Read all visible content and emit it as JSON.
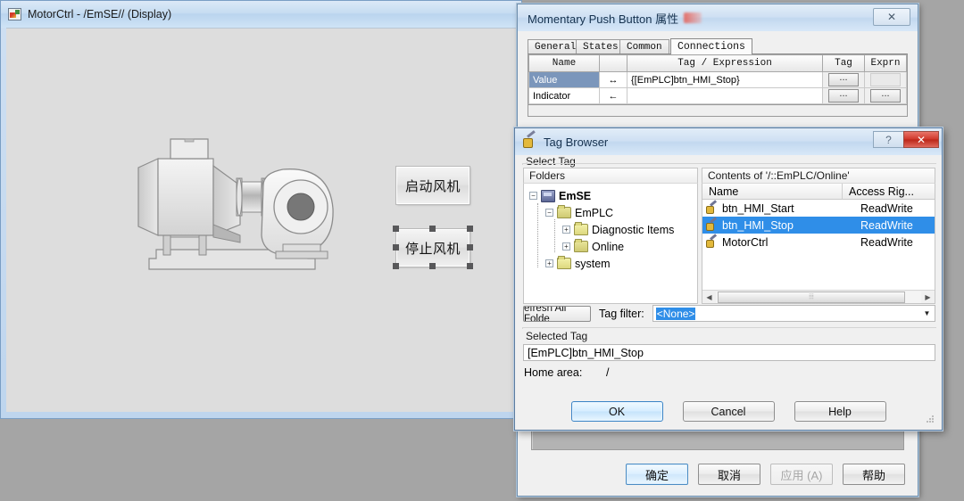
{
  "display_window": {
    "title": "MotorCtrl - /EmSE// (Display)",
    "icon": "display-icon",
    "hmi_buttons": [
      {
        "label": "启动风机",
        "name": "start-fan-button",
        "selected": false
      },
      {
        "label": "停止风机",
        "name": "stop-fan-button",
        "selected": true
      }
    ],
    "graphic": "centrifugal-fan-blower"
  },
  "mpb_dialog": {
    "title": "Momentary Push Button 属性",
    "close_label": "✕",
    "tabs": [
      {
        "label": "General",
        "active": false
      },
      {
        "label": "States",
        "active": false
      },
      {
        "label": "Common",
        "active": false
      },
      {
        "label": "Connections",
        "active": true
      }
    ],
    "connections": {
      "headers": [
        "Name",
        "",
        "Tag / Expression",
        "Tag",
        "Exprn"
      ],
      "rows": [
        {
          "name": "Value",
          "arrow": "↔",
          "expression": "{[EmPLC]btn_HMI_Stop}",
          "tag_button": "...",
          "exprn_button": "",
          "selected": true
        },
        {
          "name": "Indicator",
          "arrow": "←",
          "expression": "",
          "tag_button": "...",
          "exprn_button": "...",
          "selected": false
        }
      ]
    },
    "buttons": [
      {
        "label": "确定",
        "style": "default"
      },
      {
        "label": "取消",
        "style": "normal"
      },
      {
        "label": "应用 (A)",
        "style": "disabled"
      },
      {
        "label": "帮助",
        "style": "normal"
      }
    ]
  },
  "tag_browser": {
    "title": "Tag Browser",
    "help_label": "?",
    "close_label": "✕",
    "select_tag_label": "Select Tag",
    "folders_header": "Folders",
    "contents_header": "Contents of '/::EmPLC/Online'",
    "tree": [
      {
        "label": "EmSE",
        "depth": 0,
        "icon": "device-icon",
        "expander": "−",
        "bold": true
      },
      {
        "label": "EmPLC",
        "depth": 1,
        "icon": "folder-open-icon",
        "expander": "−",
        "bold": false
      },
      {
        "label": "Diagnostic Items",
        "depth": 2,
        "icon": "folder-icon",
        "expander": "+",
        "bold": false
      },
      {
        "label": "Online",
        "depth": 2,
        "icon": "folder-open-icon",
        "expander": "+",
        "bold": false
      },
      {
        "label": "system",
        "depth": 1,
        "icon": "folder-icon",
        "expander": "+",
        "bold": false
      }
    ],
    "contents_columns": [
      "Name",
      "Access Rig..."
    ],
    "contents_rows": [
      {
        "name": "btn_HMI_Start",
        "access": "ReadWrite",
        "selected": false
      },
      {
        "name": "btn_HMI_Stop",
        "access": "ReadWrite",
        "selected": true
      },
      {
        "name": "MotorCtrl",
        "access": "ReadWrite",
        "selected": false
      }
    ],
    "refresh_button": "efresh All Folde",
    "tag_filter_label": "Tag filter:",
    "tag_filter_value": "<None>",
    "selected_tag_label": "Selected Tag",
    "selected_tag_value": "[EmPLC]btn_HMI_Stop",
    "home_area_label": "Home area:",
    "home_area_value": "/",
    "buttons": [
      {
        "label": "OK",
        "style": "default"
      },
      {
        "label": "Cancel",
        "style": "normal"
      },
      {
        "label": "Help",
        "style": "normal"
      }
    ]
  },
  "colors": {
    "selection_blue": "#2f8ee8",
    "title_blue": "#c2d8ef",
    "desktop_gray": "#a5a5a5",
    "canvas_gray": "#dddddd",
    "close_red": "#d0382b"
  }
}
